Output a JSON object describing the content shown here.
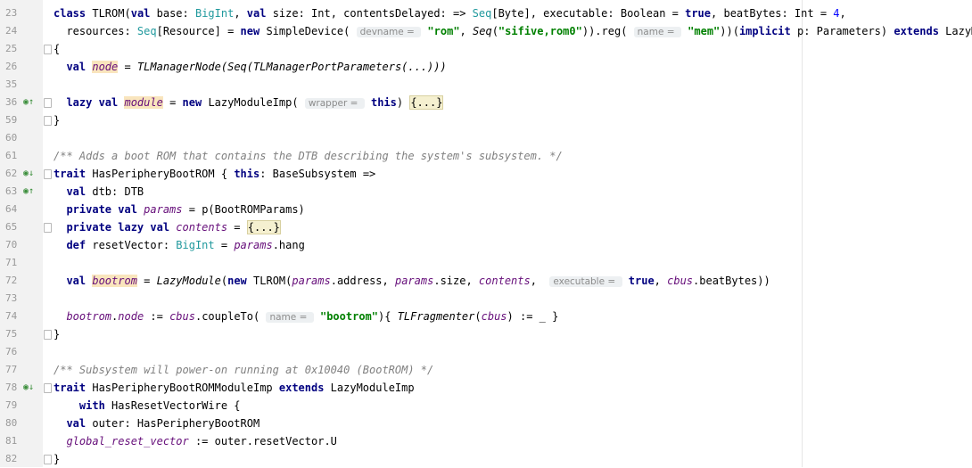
{
  "editor": {
    "lines": [
      {
        "num": "23",
        "segments": [
          {
            "t": "class ",
            "s": "kw"
          },
          {
            "t": "TLROM("
          },
          {
            "t": "val ",
            "s": "kw"
          },
          {
            "t": "base: "
          },
          {
            "t": "BigInt",
            "s": "tp"
          },
          {
            "t": ", "
          },
          {
            "t": "val ",
            "s": "kw"
          },
          {
            "t": "size: Int, contentsDelayed: => "
          },
          {
            "t": "Seq",
            "s": "tp"
          },
          {
            "t": "[Byte], executable: Boolean = "
          },
          {
            "t": "true",
            "s": "kw"
          },
          {
            "t": ", beatBytes: Int = "
          },
          {
            "t": "4",
            "s": "num"
          },
          {
            "t": ","
          }
        ]
      },
      {
        "num": "24",
        "segments": [
          {
            "t": "  resources: "
          },
          {
            "t": "Seq",
            "s": "tp"
          },
          {
            "t": "[Resource] = "
          },
          {
            "t": "new ",
            "s": "kw"
          },
          {
            "t": "SimpleDevice( "
          },
          {
            "t": "devname = ",
            "s": "hint"
          },
          {
            "t": " "
          },
          {
            "t": "\"rom\"",
            "s": "str"
          },
          {
            "t": ", "
          },
          {
            "t": "Seq",
            "s": "it"
          },
          {
            "t": "("
          },
          {
            "t": "\"sifive,rom0\"",
            "s": "str"
          },
          {
            "t": ")).reg( "
          },
          {
            "t": "name = ",
            "s": "hint"
          },
          {
            "t": " "
          },
          {
            "t": "\"mem\"",
            "s": "str"
          },
          {
            "t": "))("
          },
          {
            "t": "implicit ",
            "s": "kw"
          },
          {
            "t": "p: Parameters) "
          },
          {
            "t": "extends ",
            "s": "kw"
          },
          {
            "t": "LazyModule"
          }
        ]
      },
      {
        "num": "25",
        "fold": true,
        "segments": [
          {
            "t": "{"
          }
        ]
      },
      {
        "num": "26",
        "segments": [
          {
            "t": "  "
          },
          {
            "t": "val ",
            "s": "kw"
          },
          {
            "t": "node",
            "s": "fld hl"
          },
          {
            "t": " = "
          },
          {
            "t": "TLManagerNode(Seq(TLManagerPortParameters(...)))",
            "s": "it"
          }
        ]
      },
      {
        "num": "35",
        "segments": []
      },
      {
        "num": "36",
        "icon": "override-up",
        "fold": true,
        "segments": [
          {
            "t": "  "
          },
          {
            "t": "lazy val ",
            "s": "kw"
          },
          {
            "t": "module",
            "s": "fld hl"
          },
          {
            "t": " = "
          },
          {
            "t": "new ",
            "s": "kw"
          },
          {
            "t": "LazyModuleImp( "
          },
          {
            "t": "wrapper = ",
            "s": "hint"
          },
          {
            "t": " "
          },
          {
            "t": "this",
            "s": "kw"
          },
          {
            "t": ") "
          },
          {
            "t": "{...}",
            "s": "fb"
          }
        ]
      },
      {
        "num": "59",
        "fold": true,
        "segments": [
          {
            "t": "}"
          }
        ]
      },
      {
        "num": "60",
        "segments": []
      },
      {
        "num": "61",
        "segments": [
          {
            "t": "/** Adds a boot ROM that contains the DTB describing the system's subsystem. */",
            "s": "cmt"
          }
        ]
      },
      {
        "num": "62",
        "icon": "implemented-down",
        "fold": true,
        "segments": [
          {
            "t": "trait ",
            "s": "kw"
          },
          {
            "t": "HasPeripheryBootROM { "
          },
          {
            "t": "this",
            "s": "kw"
          },
          {
            "t": ": BaseSubsystem =>"
          }
        ]
      },
      {
        "num": "63",
        "icon": "override-up",
        "segments": [
          {
            "t": "  "
          },
          {
            "t": "val ",
            "s": "kw"
          },
          {
            "t": "dtb: DTB"
          }
        ]
      },
      {
        "num": "64",
        "segments": [
          {
            "t": "  "
          },
          {
            "t": "private val ",
            "s": "kw"
          },
          {
            "t": "params",
            "s": "fld"
          },
          {
            "t": " = p(BootROMParams)"
          }
        ]
      },
      {
        "num": "65",
        "fold": true,
        "segments": [
          {
            "t": "  "
          },
          {
            "t": "private lazy val ",
            "s": "kw"
          },
          {
            "t": "contents",
            "s": "fld"
          },
          {
            "t": " = "
          },
          {
            "t": "{...}",
            "s": "fb"
          }
        ]
      },
      {
        "num": "70",
        "segments": [
          {
            "t": "  "
          },
          {
            "t": "def ",
            "s": "kw"
          },
          {
            "t": "resetVector: "
          },
          {
            "t": "BigInt",
            "s": "tp"
          },
          {
            "t": " = "
          },
          {
            "t": "params",
            "s": "fld"
          },
          {
            "t": ".hang"
          }
        ]
      },
      {
        "num": "71",
        "segments": []
      },
      {
        "num": "72",
        "segments": [
          {
            "t": "  "
          },
          {
            "t": "val ",
            "s": "kw"
          },
          {
            "t": "bootrom",
            "s": "fld hl"
          },
          {
            "t": " = "
          },
          {
            "t": "LazyModule",
            "s": "it"
          },
          {
            "t": "("
          },
          {
            "t": "new ",
            "s": "kw"
          },
          {
            "t": "TLROM("
          },
          {
            "t": "params",
            "s": "fld"
          },
          {
            "t": ".address, "
          },
          {
            "t": "params",
            "s": "fld"
          },
          {
            "t": ".size, "
          },
          {
            "t": "contents",
            "s": "fld"
          },
          {
            "t": ",  "
          },
          {
            "t": "executable = ",
            "s": "hint"
          },
          {
            "t": " "
          },
          {
            "t": "true",
            "s": "kw"
          },
          {
            "t": ", "
          },
          {
            "t": "cbus",
            "s": "fld"
          },
          {
            "t": ".beatBytes))"
          }
        ]
      },
      {
        "num": "73",
        "segments": []
      },
      {
        "num": "74",
        "segments": [
          {
            "t": "  "
          },
          {
            "t": "bootrom",
            "s": "fld"
          },
          {
            "t": "."
          },
          {
            "t": "node",
            "s": "fld"
          },
          {
            "t": " := "
          },
          {
            "t": "cbus",
            "s": "fld"
          },
          {
            "t": ".coupleTo( "
          },
          {
            "t": "name = ",
            "s": "hint"
          },
          {
            "t": " "
          },
          {
            "t": "\"bootrom\"",
            "s": "str"
          },
          {
            "t": "){ "
          },
          {
            "t": "TLFragmenter",
            "s": "it"
          },
          {
            "t": "("
          },
          {
            "t": "cbus",
            "s": "fld"
          },
          {
            "t": ") := _ }"
          }
        ]
      },
      {
        "num": "75",
        "fold": true,
        "segments": [
          {
            "t": "}"
          }
        ]
      },
      {
        "num": "76",
        "segments": []
      },
      {
        "num": "77",
        "segments": [
          {
            "t": "/** Subsystem will power-on running at 0x10040 (BootROM) */",
            "s": "cmt"
          }
        ]
      },
      {
        "num": "78",
        "icon": "implemented-down",
        "fold": true,
        "segments": [
          {
            "t": "trait ",
            "s": "kw"
          },
          {
            "t": "HasPeripheryBootROMModuleImp "
          },
          {
            "t": "extends ",
            "s": "kw"
          },
          {
            "t": "LazyModuleImp"
          }
        ]
      },
      {
        "num": "79",
        "segments": [
          {
            "t": "    "
          },
          {
            "t": "with ",
            "s": "kw"
          },
          {
            "t": "HasResetVectorWire {"
          }
        ]
      },
      {
        "num": "80",
        "segments": [
          {
            "t": "  "
          },
          {
            "t": "val ",
            "s": "kw"
          },
          {
            "t": "outer: HasPeripheryBootROM"
          }
        ]
      },
      {
        "num": "81",
        "segments": [
          {
            "t": "  "
          },
          {
            "t": "global_reset_vector",
            "s": "fld"
          },
          {
            "t": " := outer.resetVector.U"
          }
        ]
      },
      {
        "num": "82",
        "fold": true,
        "segments": [
          {
            "t": "}"
          }
        ]
      }
    ]
  }
}
